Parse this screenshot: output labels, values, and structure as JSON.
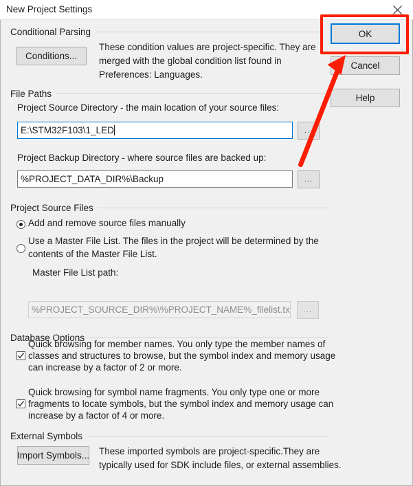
{
  "window": {
    "title": "New Project Settings",
    "close_icon": "close-icon"
  },
  "action_buttons": {
    "ok": "OK",
    "cancel": "Cancel",
    "help": "Help"
  },
  "groups": {
    "conditional_parsing": {
      "title": "Conditional Parsing",
      "conditions_button": "Conditions...",
      "description_line1": "These condition values are project-specific.  They are",
      "description_line2": "merged with the global condition list found in",
      "description_line3": "Preferences: Languages."
    },
    "file_paths": {
      "title": "File Paths",
      "source_dir_label": "Project Source Directory - the main location of your source files:",
      "source_dir_value": "E:\\STM32F103\\1_LED",
      "source_dir_browse": "...",
      "backup_dir_label": "Project Backup Directory - where source files are backed up:",
      "backup_dir_value": "%PROJECT_DATA_DIR%\\Backup",
      "backup_dir_browse": "..."
    },
    "project_source_files": {
      "title": "Project Source Files",
      "option_manual": "Add and remove source files manually",
      "option_manual_selected": true,
      "option_master_line1": "Use a Master File List. The files in the project will be determined by the",
      "option_master_line2": "contents of the Master File List.",
      "option_master_selected": false,
      "master_path_label": "Master File List path:",
      "master_path_value": "%PROJECT_SOURCE_DIR%\\%PROJECT_NAME%_filelist.txt",
      "master_path_browse": "..."
    },
    "database_options": {
      "title": "Database Options",
      "member_names": {
        "checked": true,
        "line1": "Quick browsing for member names.  You only type the member names of",
        "line2": "classes and structures to browse, but the symbol index and memory usage",
        "line3": "can increase by a factor of 2 or more."
      },
      "name_fragments": {
        "checked": true,
        "line1": "Quick browsing for symbol name fragments.  You only type one or more",
        "line2": "fragments to locate symbols, but the symbol index and memory usage can",
        "line3": "increase by a factor of 4 or more."
      }
    },
    "external_symbols": {
      "title": "External Symbols",
      "import_button": "Import Symbols...",
      "description_line1": "These imported symbols are project-specific.They are",
      "description_line2": "typically used for SDK include files, or external assemblies."
    }
  },
  "annotation": {
    "highlight_color": "#fb1e04",
    "focus_color": "#0078d7",
    "target": "OK"
  }
}
